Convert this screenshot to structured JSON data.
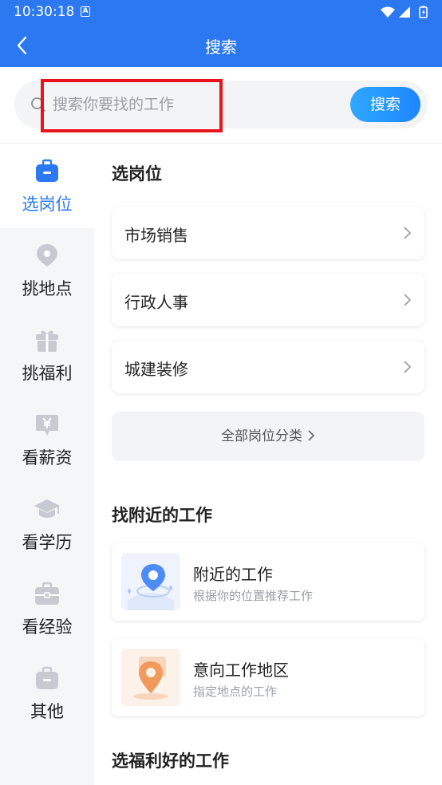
{
  "status_bar": {
    "time": "10:30:18",
    "notification_icon": "A"
  },
  "nav": {
    "title": "搜索",
    "back_icon": "chevron-left-icon"
  },
  "search": {
    "placeholder": "搜索你要找的工作",
    "value": "",
    "button_label": "搜索"
  },
  "sidebar": {
    "items": [
      {
        "label": "选岗位",
        "icon": "briefcase-icon",
        "active": true
      },
      {
        "label": "挑地点",
        "icon": "location-pin-icon",
        "active": false
      },
      {
        "label": "挑福利",
        "icon": "gift-icon",
        "active": false
      },
      {
        "label": "看薪资",
        "icon": "yen-icon",
        "active": false
      },
      {
        "label": "看学历",
        "icon": "graduation-cap-icon",
        "active": false
      },
      {
        "label": "看经验",
        "icon": "toolbox-icon",
        "active": false
      },
      {
        "label": "其他",
        "icon": "bag-icon",
        "active": false
      }
    ]
  },
  "content": {
    "positions": {
      "title": "选岗位",
      "categories": [
        "市场销售",
        "行政人事",
        "城建装修"
      ],
      "all_label": "全部岗位分类"
    },
    "nearby": {
      "title": "找附近的工作",
      "cards": [
        {
          "title": "附近的工作",
          "subtitle": "根据你的位置推荐工作"
        },
        {
          "title": "意向工作地区",
          "subtitle": "指定地点的工作"
        }
      ]
    },
    "benefits": {
      "title": "选福利好的工作"
    }
  },
  "colors": {
    "primary": "#2b78f0",
    "highlight_box": "#e8131a",
    "sidebar_bg": "#f5f6f8"
  }
}
